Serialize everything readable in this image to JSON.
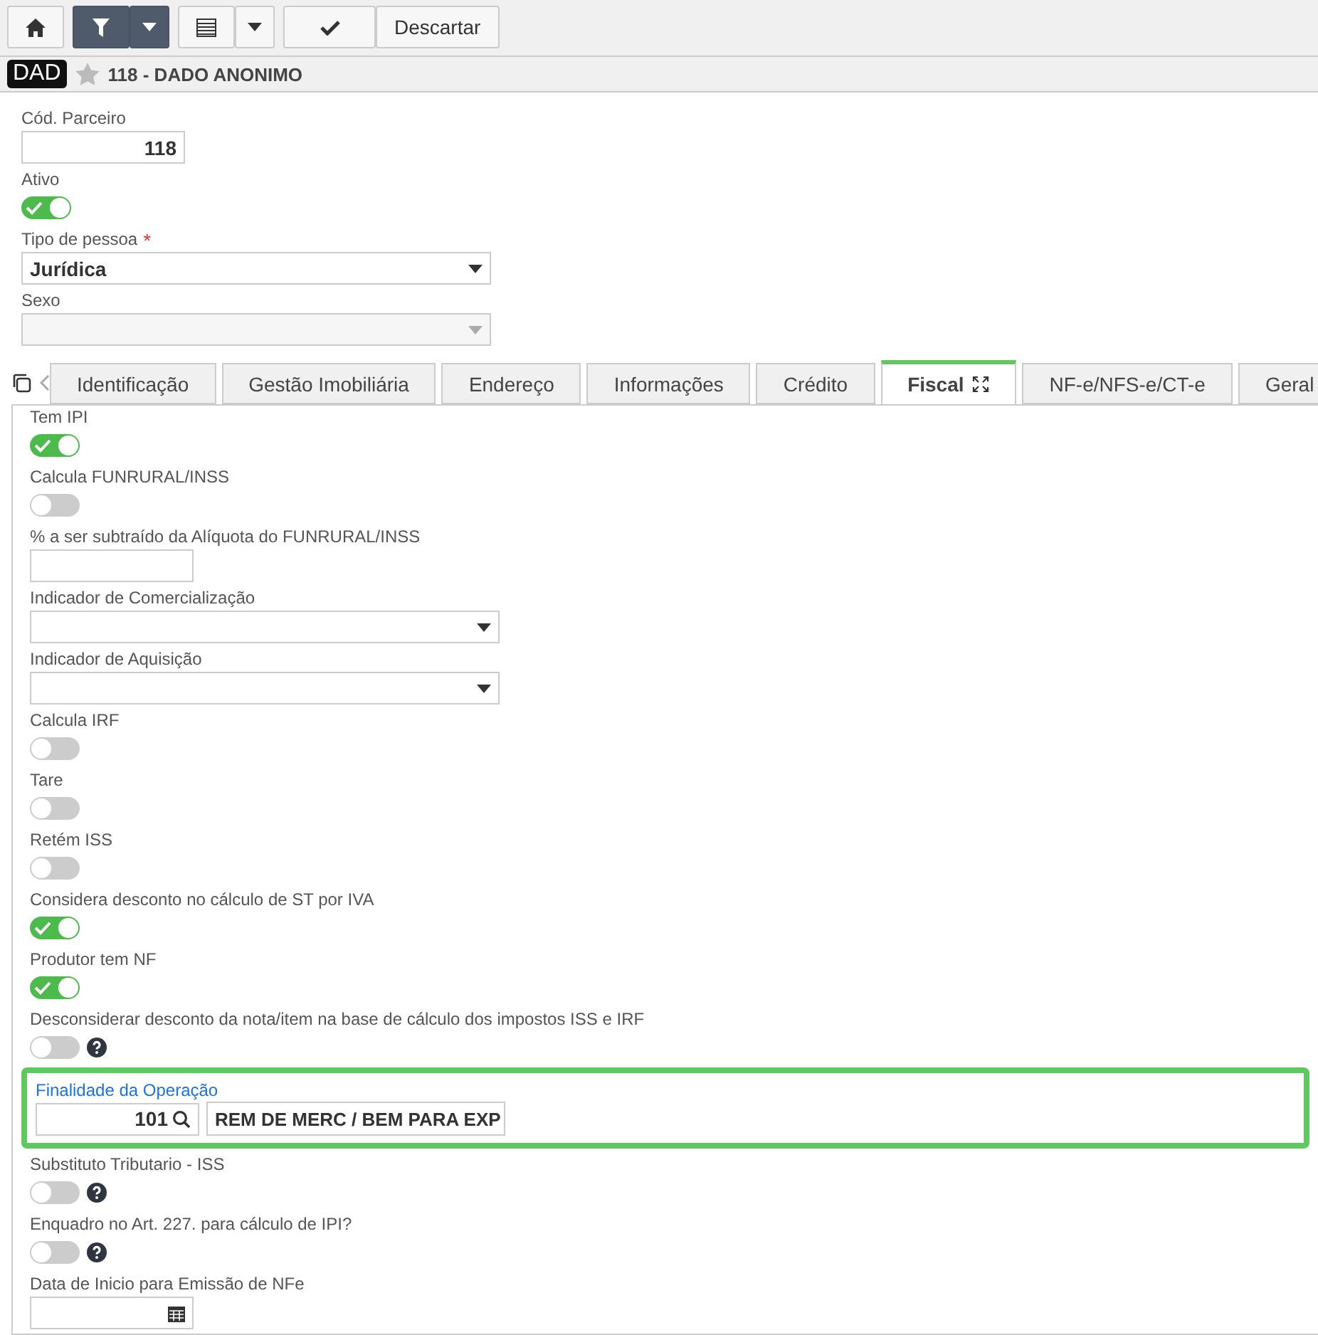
{
  "toolbar": {
    "discard_label": "Descartar"
  },
  "header": {
    "badge": "DAD",
    "title": "118 - DADO ANONIMO",
    "favorite": false
  },
  "form": [
    {
      "kind": "input",
      "label": "Cód. Parceiro",
      "value": "118"
    },
    {
      "kind": "toggle",
      "label": "Ativo",
      "on": true
    },
    {
      "kind": "select",
      "label": "Tipo de pessoa",
      "value": "Jurídica",
      "required_mark": "*",
      "disabled": false
    },
    {
      "kind": "select",
      "label": "Sexo",
      "disabled": true
    }
  ],
  "tabs": [
    {
      "label": "Identificação",
      "selected": false
    },
    {
      "label": "Gestão Imobiliária",
      "selected": false
    },
    {
      "label": "Endereço",
      "selected": false
    },
    {
      "label": "Informações",
      "selected": false
    },
    {
      "label": "Crédito",
      "selected": false
    },
    {
      "label": "Fiscal",
      "selected": true
    },
    {
      "label": "NF-e/NFS-e/CT-e",
      "selected": false
    },
    {
      "label": "Geral",
      "selected": false
    }
  ],
  "fields": [
    {
      "kind": "toggle",
      "label": "Tem IPI",
      "on": true,
      "help": false,
      "highlighted": false
    },
    {
      "kind": "toggle",
      "label": "Calcula FUNRURAL/INSS",
      "on": false,
      "help": false,
      "highlighted": false
    },
    {
      "kind": "input",
      "label": "% a ser subtraído da Alíquota do FUNRURAL/INSS",
      "help": false,
      "highlighted": false
    },
    {
      "kind": "select",
      "label": "Indicador de Comercialização",
      "help": false,
      "highlighted": false
    },
    {
      "kind": "select",
      "label": "Indicador de Aquisição",
      "help": false,
      "highlighted": false
    },
    {
      "kind": "toggle",
      "label": "Calcula IRF",
      "on": false,
      "help": false,
      "highlighted": false
    },
    {
      "kind": "toggle",
      "label": "Tare",
      "on": false,
      "help": false,
      "highlighted": false
    },
    {
      "kind": "toggle",
      "label": "Retém ISS",
      "on": false,
      "help": false,
      "highlighted": false
    },
    {
      "kind": "toggle",
      "label": "Considera desconto no cálculo de ST por IVA",
      "on": true,
      "help": false,
      "highlighted": false
    },
    {
      "kind": "toggle",
      "label": "Produtor tem NF",
      "on": true,
      "help": false,
      "highlighted": false
    },
    {
      "kind": "toggle",
      "label": "Desconsiderar desconto da nota/item na base de cálculo dos impostos ISS e IRF",
      "on": false,
      "help": true,
      "highlighted": false
    },
    {
      "kind": "lookup",
      "label": "Finalidade da Operação",
      "value": "101",
      "description": "REM DE MERC / BEM PARA EXP",
      "help": false,
      "highlighted": true
    },
    {
      "kind": "toggle",
      "label": "Substituto Tributario - ISS",
      "on": false,
      "help": true,
      "highlighted": false
    },
    {
      "kind": "toggle",
      "label": "Enquadro no Art. 227. para cálculo de IPI?",
      "on": false,
      "help": true,
      "highlighted": false
    },
    {
      "kind": "date",
      "label": "Data de Inicio para Emissão de NFe",
      "help": false,
      "highlighted": false
    }
  ]
}
